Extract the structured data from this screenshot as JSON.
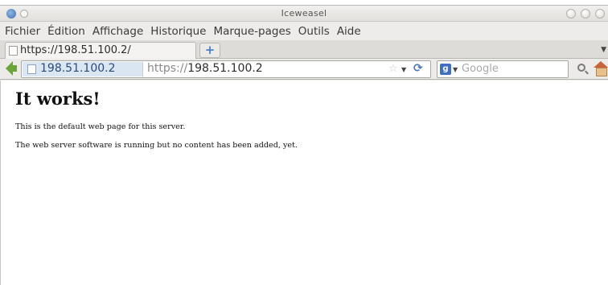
{
  "window": {
    "title": "Iceweasel"
  },
  "menubar": {
    "items": [
      "Fichier",
      "Édition",
      "Affichage",
      "Historique",
      "Marque-pages",
      "Outils",
      "Aide"
    ]
  },
  "tabs": [
    {
      "title": "https://198.51.100.2/"
    }
  ],
  "navbar": {
    "identity": "198.51.100.2",
    "url_scheme": "https://",
    "url_host": "198.51.100.2",
    "search_placeholder": "Google"
  },
  "page": {
    "heading": "It works!",
    "paragraphs": [
      "This is the default web page for this server.",
      "The web server software is running but no content has been added, yet."
    ]
  },
  "colors": {
    "identity_bg": "#dbe6f3",
    "back_arrow": "#6aa43a",
    "reload": "#4b77b4"
  }
}
